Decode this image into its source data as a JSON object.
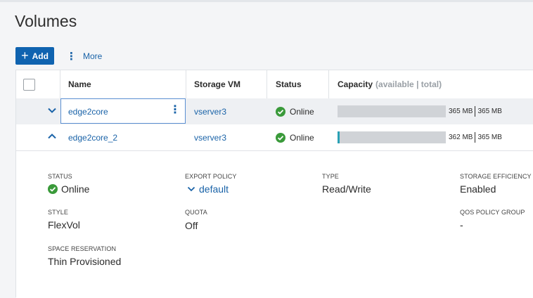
{
  "page": {
    "title": "Volumes"
  },
  "toolbar": {
    "add_label": "Add",
    "more_label": "More"
  },
  "table": {
    "headers": {
      "name": "Name",
      "storage_vm": "Storage VM",
      "status": "Status",
      "capacity": "Capacity",
      "capacity_sub": "(available | total)"
    },
    "rows": [
      {
        "name": "edge2core",
        "storage_vm": "vserver3",
        "status": "Online",
        "available": "365 MB",
        "total": "365 MB",
        "used_fraction": 0.0
      },
      {
        "name": "edge2core_2",
        "storage_vm": "vserver3",
        "status": "Online",
        "available": "362 MB",
        "total": "365 MB",
        "used_fraction": 0.01
      }
    ]
  },
  "details": {
    "status_label": "STATUS",
    "status_value": "Online",
    "export_policy_label": "EXPORT POLICY",
    "export_policy_value": "default",
    "type_label": "TYPE",
    "type_value": "Read/Write",
    "storage_efficiency_label": "STORAGE EFFICIENCY",
    "storage_efficiency_value": "Enabled",
    "style_label": "STYLE",
    "style_value": "FlexVol",
    "quota_label": "QUOTA",
    "quota_value": "Off",
    "qos_label": "QOS POLICY GROUP",
    "qos_value": "-",
    "space_reservation_label": "SPACE RESERVATION",
    "space_reservation_value": "Thin Provisioned"
  },
  "colors": {
    "accent": "#0f63b0",
    "link": "#1a63a8",
    "online": "#3a9a3a",
    "bar_bg": "#d0d3d7",
    "bar_fill": "#2aa1b5"
  },
  "icons": [
    "plus-icon",
    "kebab-icon",
    "chevron-down-icon",
    "chevron-up-icon",
    "check-circle-icon"
  ]
}
